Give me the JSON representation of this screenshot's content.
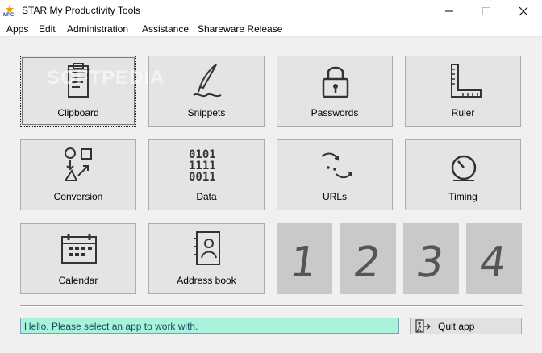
{
  "window": {
    "title": "STAR My Productivity Tools",
    "icon": "app-logo-icon",
    "controls": [
      "minimize-icon",
      "maximize-icon",
      "close-icon"
    ]
  },
  "menu": [
    "Apps",
    "Edit",
    "Administration",
    "Assistance",
    "Shareware Release"
  ],
  "tiles": [
    {
      "label": "Clipboard",
      "icon": "clipboard-icon"
    },
    {
      "label": "Snippets",
      "icon": "quill-pen-icon"
    },
    {
      "label": "Passwords",
      "icon": "padlock-icon"
    },
    {
      "label": "Ruler",
      "icon": "ruler-icon"
    },
    {
      "label": "Conversion",
      "icon": "shapes-conversion-icon"
    },
    {
      "label": "Data",
      "icon": "binary-data-icon"
    },
    {
      "label": "URLs",
      "icon": "url-arrows-icon"
    },
    {
      "label": "Timing",
      "icon": "stopwatch-icon"
    },
    {
      "label": "Calendar",
      "icon": "calendar-icon"
    },
    {
      "label": "Address book",
      "icon": "address-book-icon"
    }
  ],
  "number_tiles": [
    "1",
    "2",
    "3",
    "4"
  ],
  "status_text": "Hello. Please select an app to work with.",
  "quit_label": "Quit app",
  "watermark": "SOFTPEDIA",
  "colors": {
    "status_bg": "#a9f3dd",
    "tile_bg": "#e4e4e4",
    "number_tile_bg": "#c9c9c9"
  }
}
